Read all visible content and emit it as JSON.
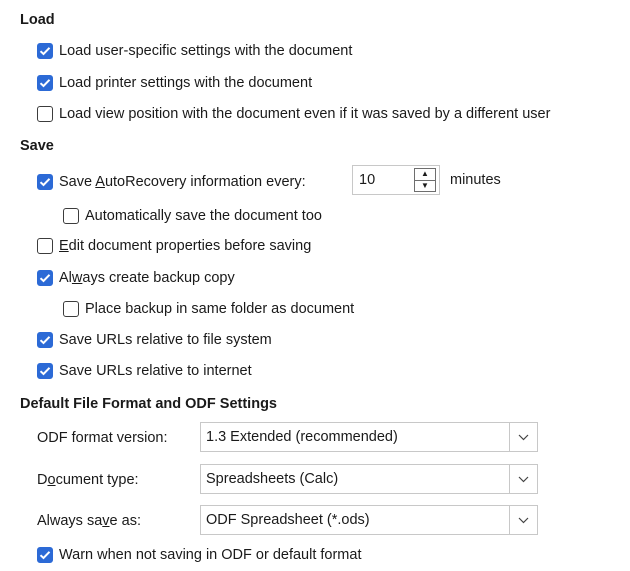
{
  "load": {
    "heading": "Load",
    "user_settings": {
      "label": "Load user-specific settings with the document",
      "checked": true
    },
    "printer_settings": {
      "label": "Load printer settings with the document",
      "checked": true
    },
    "view_position": {
      "label": "Load view position with the document even if it was saved by a different user",
      "checked": false
    }
  },
  "save": {
    "heading": "Save",
    "autorecovery": {
      "label_pre": "Save ",
      "label_mnemonic": "A",
      "label_post": "utoRecovery information every:",
      "checked": true,
      "interval": "10",
      "unit": "minutes"
    },
    "auto_save_doc": {
      "label": "Automatically save the document too",
      "checked": false
    },
    "edit_props": {
      "label_mnemonic": "E",
      "label_post": "dit document properties before saving",
      "checked": false
    },
    "backup_copy": {
      "label_pre": "Al",
      "label_mnemonic": "w",
      "label_post": "ays create backup copy",
      "checked": true
    },
    "backup_same_folder": {
      "label": "Place backup in same folder as document",
      "checked": false
    },
    "urls_file_system": {
      "label": "Save URLs relative to file system",
      "checked": true
    },
    "urls_internet": {
      "label": "Save URLs relative to internet",
      "checked": true
    }
  },
  "default_format": {
    "heading": "Default File Format and ODF Settings",
    "odf_version": {
      "label": "ODF format version:",
      "value": "1.3 Extended (recommended)"
    },
    "doc_type": {
      "label_pre": "D",
      "label_mnemonic": "o",
      "label_post": "cument type:",
      "value": "Spreadsheets (Calc)"
    },
    "save_as": {
      "label_pre": "Always sa",
      "label_mnemonic": "v",
      "label_post": "e as:",
      "value": "ODF Spreadsheet (*.ods)"
    },
    "warn": {
      "label": "Warn when not saving in ODF or default format",
      "checked": true
    }
  },
  "colors": {
    "accent": "#2c6ad6"
  },
  "icons": {
    "checkmark": "check-icon",
    "dropdown": "chevron-down-icon",
    "spin_up": "spin-up-icon",
    "spin_down": "spin-down-icon"
  }
}
